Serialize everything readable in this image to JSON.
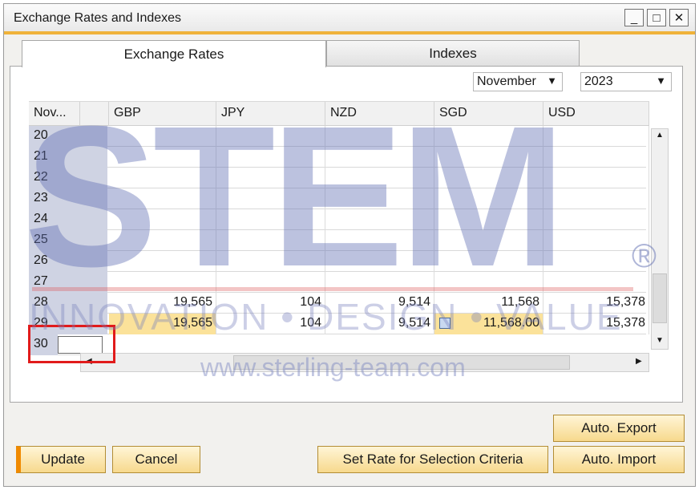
{
  "window": {
    "title": "Exchange Rates and Indexes",
    "minimize": "_",
    "maximize": "□",
    "close": "✕"
  },
  "tabs": [
    {
      "label": "Exchange Rates"
    },
    {
      "label": "Indexes"
    }
  ],
  "filters": {
    "month": "November",
    "year": "2023"
  },
  "grid": {
    "row_header": "Nov...",
    "columns": [
      "GBP",
      "JPY",
      "NZD",
      "SGD",
      "USD"
    ],
    "rows": [
      {
        "day": "20",
        "values": [
          "",
          "",
          "",
          "",
          ""
        ]
      },
      {
        "day": "21",
        "values": [
          "",
          "",
          "",
          "",
          ""
        ]
      },
      {
        "day": "22",
        "values": [
          "",
          "",
          "",
          "",
          ""
        ]
      },
      {
        "day": "23",
        "values": [
          "",
          "",
          "",
          "",
          ""
        ]
      },
      {
        "day": "24",
        "values": [
          "",
          "",
          "",
          "",
          ""
        ]
      },
      {
        "day": "25",
        "values": [
          "",
          "",
          "",
          "",
          ""
        ]
      },
      {
        "day": "26",
        "values": [
          "",
          "",
          "",
          "",
          ""
        ]
      },
      {
        "day": "27",
        "values": [
          "",
          "",
          "",
          "",
          ""
        ]
      },
      {
        "day": "28",
        "values": [
          "19,565",
          "104",
          "9,514",
          "11,568",
          "15,378"
        ]
      },
      {
        "day": "29",
        "values": [
          "19,565",
          "104",
          "9,514",
          "11,568.00",
          "15,378"
        ]
      },
      {
        "day": "30",
        "values": [
          "",
          "",
          "",
          "",
          ""
        ]
      }
    ]
  },
  "buttons": {
    "update": "Update",
    "cancel": "Cancel",
    "set_rate": "Set Rate for Selection Criteria",
    "auto_export": "Auto. Export",
    "auto_import": "Auto. Import"
  },
  "watermark": {
    "logo": "STEM",
    "registered": "®",
    "tagline": "INNOVATION • DESIGN • VALUE",
    "url": "www.sterling-team.com"
  },
  "colors": {
    "accent": "#f0b33a",
    "highlight": "#fbe29a",
    "rowheader": "#cfd3e3",
    "redbox": "#e11b1b"
  }
}
